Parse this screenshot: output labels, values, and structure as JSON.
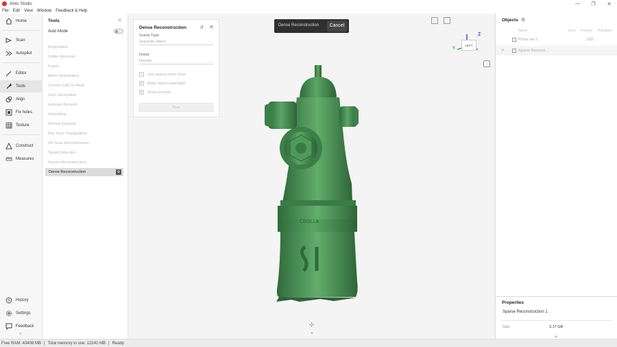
{
  "app": {
    "title": "Artec Studio"
  },
  "window_controls": {
    "minimize": "—",
    "restore": "❐",
    "close": "✕"
  },
  "menu": [
    "File",
    "Edit",
    "View",
    "Window",
    "Feedback & Help"
  ],
  "nav": {
    "top": [
      {
        "label": "Home",
        "icon": "home-icon"
      },
      {
        "label": "Scan",
        "icon": "scan-icon"
      },
      {
        "label": "Autopilot",
        "icon": "autopilot-icon"
      },
      {
        "label": "Editor",
        "icon": "editor-icon"
      },
      {
        "label": "Tools",
        "icon": "tools-icon",
        "active": true
      },
      {
        "label": "Align",
        "icon": "align-icon"
      },
      {
        "label": "Fix holes",
        "icon": "fix-holes-icon"
      },
      {
        "label": "Texture",
        "icon": "texture-icon"
      },
      {
        "label": "Construct",
        "icon": "construct-icon"
      },
      {
        "label": "Measures",
        "icon": "measures-icon"
      }
    ],
    "bottom": [
      {
        "label": "History",
        "icon": "history-icon"
      },
      {
        "label": "Settings",
        "icon": "settings-icon"
      },
      {
        "label": "Feedback",
        "icon": "feedback-icon"
      }
    ],
    "collapse": "»"
  },
  "tools": {
    "title": "Tools",
    "close": "✕",
    "auto_mode": "Auto Mode",
    "items": [
      "Registration",
      "Outlier Removal",
      "Fusion",
      "Mesh Optimization",
      "Convert CAD to Mesh",
      "Scan Decimation",
      "Isotropic Remesh",
      "Smoothing",
      "Normal Inversion",
      "Ray Scan Triangulation",
      "HD Scan Reconstruction",
      "Target Detection",
      "Sparse Reconstruction"
    ],
    "active": "Dense Reconstruction",
    "active_btn": "⚙"
  },
  "dense": {
    "title": "Dense Reconstruction",
    "reset": "↺",
    "close": "✕",
    "scene_type_label": "Scene Type",
    "scene_type_value": "Separate object",
    "detail_label": "Detail",
    "detail_value": "Normal",
    "chev": "⌄",
    "checks": [
      {
        "label": "Use sparse point cloud",
        "checked": false,
        "mark": ""
      },
      {
        "label": "Make object watertight",
        "checked": true,
        "mark": "✓"
      },
      {
        "label": "Show preview",
        "checked": true,
        "mark": "✓"
      }
    ],
    "run": "Run"
  },
  "progress": {
    "label": "Dense Reconstruction",
    "cancel": "Cancel"
  },
  "gizmo": {
    "face": "LEFT",
    "z": "Z",
    "y": "Y"
  },
  "objects": {
    "title": "Objects",
    "gear": "⚙",
    "columns": [
      "Name",
      "Error",
      "Frames",
      "Polygons"
    ],
    "rows": [
      {
        "name": "Photo set 1",
        "frames": "258",
        "check": ""
      },
      {
        "name": "Sparse Reconst...",
        "frames": "",
        "check": "✓"
      }
    ]
  },
  "properties": {
    "title": "Properties",
    "object": "Sparse Reconstruction 1",
    "size_label": "Size",
    "size_value": "3.17 GB",
    "expand": "»"
  },
  "status": {
    "free_ram": "Free RAM: 43408 MB",
    "total_memory": "Total memory in use: 12242 MB",
    "state": "Ready",
    "sep": "|"
  },
  "viewport_controls": {
    "pivot": "⊹",
    "expand_up": "⌃"
  },
  "colors": {
    "model": "#4a8f55",
    "model_dark": "#2f6a3a",
    "accent": "#333333"
  }
}
